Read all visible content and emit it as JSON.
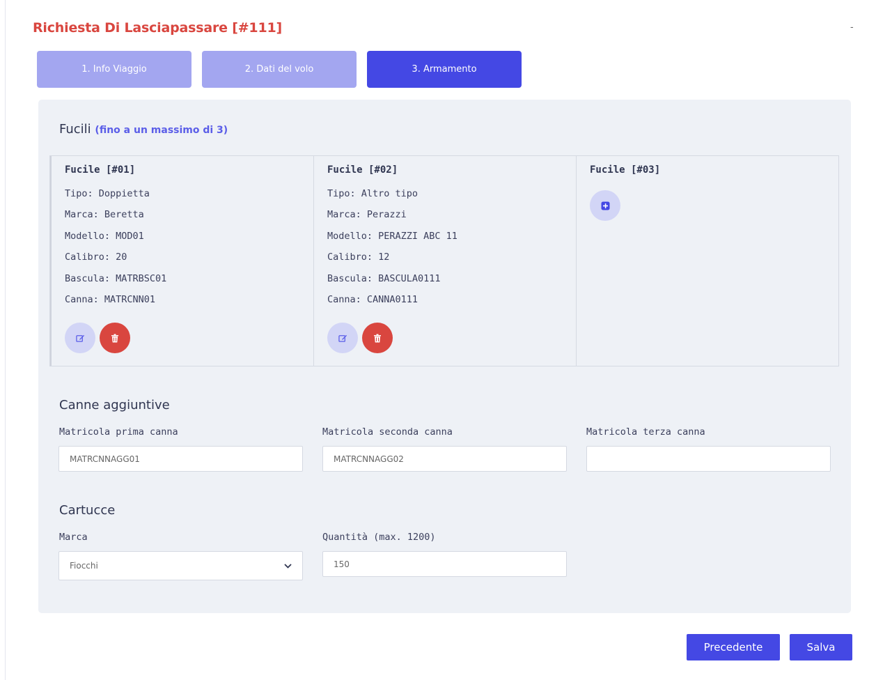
{
  "header": {
    "title": "Richiesta Di Lasciapassare [#111]",
    "collapse_mark": "-"
  },
  "steps": [
    {
      "label": "1. Info Viaggio",
      "active": false
    },
    {
      "label": "2. Dati del volo",
      "active": false
    },
    {
      "label": "3. Armamento",
      "active": true
    }
  ],
  "fucili": {
    "title": "Fucili",
    "note": "(fino a un massimo di 3)",
    "guns": [
      {
        "heading": "Fucile [#01]",
        "lines": [
          "Tipo: Doppietta",
          "Marca: Beretta",
          "Modello: MOD01",
          "Calibro: 20",
          "Bascula: MATRBSC01",
          "Canna: MATRCNN01"
        ]
      },
      {
        "heading": "Fucile [#02]",
        "lines": [
          "Tipo: Altro tipo",
          "Marca: Perazzi",
          "Modello: PERAZZI ABC 11",
          "Calibro: 12",
          "Bascula: BASCULA0111",
          "Canna: CANNA0111"
        ]
      },
      {
        "heading": "Fucile [#03]",
        "lines": []
      }
    ]
  },
  "canne": {
    "title": "Canne aggiuntive",
    "fields": [
      {
        "label": "Matricola prima canna",
        "value": "MATRCNNAGG01"
      },
      {
        "label": "Matricola seconda canna",
        "value": "MATRCNNAGG02"
      },
      {
        "label": "Matricola terza canna",
        "value": ""
      }
    ]
  },
  "cartucce": {
    "title": "Cartucce",
    "marca_label": "Marca",
    "marca_value": "Fiocchi",
    "quantita_label": "Quantità (max. 1200)",
    "quantita_value": "150"
  },
  "footer": {
    "prev_label": "Precedente",
    "save_label": "Salva"
  },
  "colors": {
    "title_red": "#d9463f",
    "primary": "#4448e4",
    "tab_inactive": "#a3a6f0",
    "panel_bg": "#eef1f6"
  },
  "icons": {
    "edit": "edit-icon",
    "delete": "trash-icon",
    "add": "plus-square-icon",
    "select": "chevron-down-icon"
  }
}
